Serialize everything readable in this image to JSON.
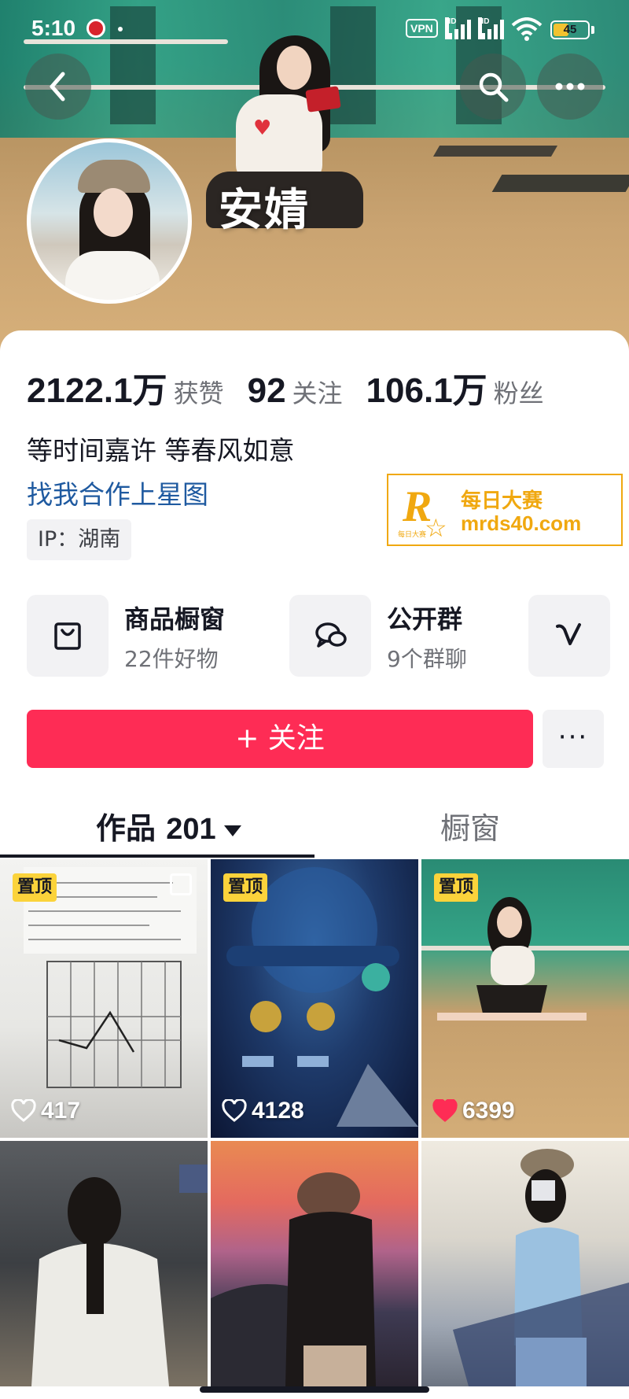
{
  "status_bar": {
    "time": "5:10",
    "vpn": "VPN",
    "battery": "45",
    "battery_level": 0.45,
    "signal_label": "HD"
  },
  "profile": {
    "name": "安婧",
    "stats": [
      {
        "value": "2122.1万",
        "label": "获赞"
      },
      {
        "value": "92",
        "label": "关注"
      },
      {
        "value": "106.1万",
        "label": "粉丝"
      }
    ],
    "bio": "等时间嘉许 等春风如意",
    "link": "找我合作上星图",
    "ip": "IP：湖南"
  },
  "watermark": {
    "logo": "R",
    "logo_small": "每日大赛",
    "title": "每日大赛",
    "url": "mrds40.com",
    "color": "#f0a810"
  },
  "shortcuts": [
    {
      "icon": "shopping-bag-icon",
      "title": "商品橱窗",
      "subtitle": "22件好物"
    },
    {
      "icon": "group-chat-icon",
      "title": "公开群",
      "subtitle": "9个群聊"
    },
    {
      "icon": "v-badge-icon",
      "title": "",
      "subtitle": ""
    }
  ],
  "actions": {
    "follow": "+ 关注",
    "more": "···",
    "follow_color": "#fe2c55"
  },
  "tabs": {
    "works_label": "作品",
    "works_count": "201",
    "window_label": "橱窗"
  },
  "videos": [
    {
      "pinned": "置顶",
      "likes": "417",
      "liked": false
    },
    {
      "pinned": "置顶",
      "likes": "4128",
      "liked": false
    },
    {
      "pinned": "置顶",
      "likes": "6399",
      "liked": true
    },
    {
      "pinned": "",
      "likes": "",
      "liked": false
    },
    {
      "pinned": "",
      "likes": "",
      "liked": false
    },
    {
      "pinned": "",
      "likes": "",
      "liked": false
    }
  ]
}
